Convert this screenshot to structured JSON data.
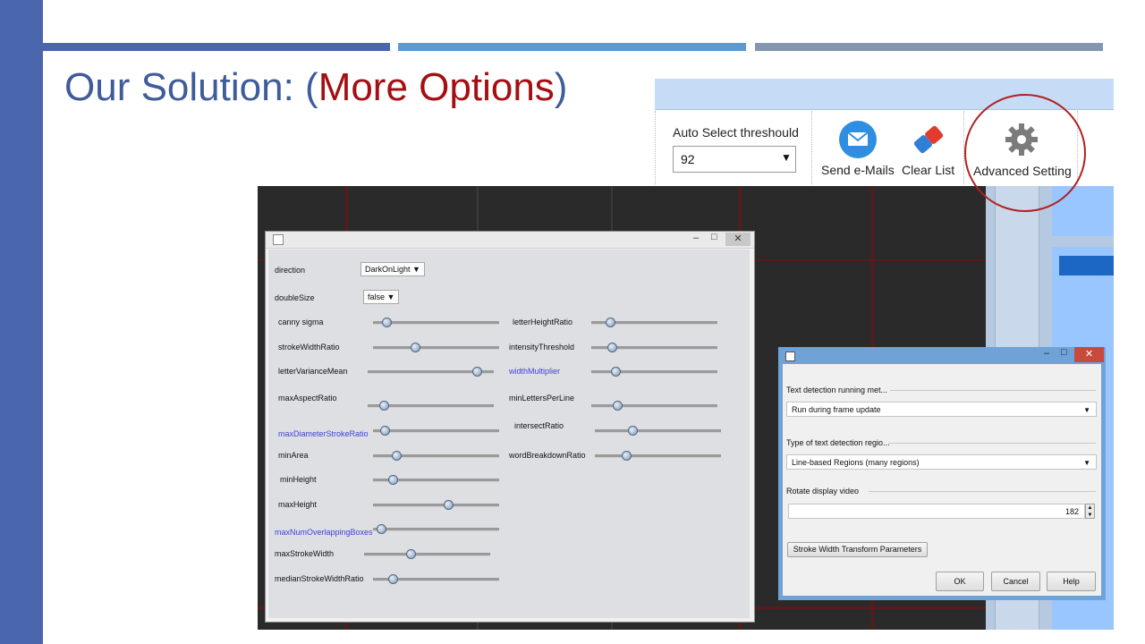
{
  "slide": {
    "title_prefix": "Our Solution: (",
    "title_highlight": "More Options",
    "title_suffix": ")"
  },
  "toolbar": {
    "threshold_label": "Auto Select threshould",
    "threshold_value": "92",
    "send_label": "Send e-Mails",
    "clear_label": "Clear List",
    "advanced_label": "Advanced Setting"
  },
  "swt_dialog": {
    "minimize": "–",
    "maximize": "□",
    "close": "✕",
    "direction_label": "direction",
    "direction_value": "DarkOnLight",
    "doublesize_label": "doubleSize",
    "doublesize_value": "false",
    "sliders_left": [
      {
        "label": "canny sigma",
        "value": 0.08
      },
      {
        "label": "strokeWidthRatio",
        "value": 0.32
      },
      {
        "label": "letterVarianceMean",
        "value": 0.89
      },
      {
        "label": "maxAspectRatio",
        "value": 0.1
      },
      {
        "label": "maxDiameterStrokeRatio",
        "value": 0.06
      },
      {
        "label": "minArea",
        "value": 0.16
      },
      {
        "label": "minHeight",
        "value": 0.13
      },
      {
        "label": "maxHeight",
        "value": 0.6
      },
      {
        "label": "maxNumOverlappingBoxes",
        "value": 0.03
      },
      {
        "label": "maxStrokeWidth",
        "value": 0.36
      },
      {
        "label": "medianStrokeWidthRatio",
        "value": 0.13
      }
    ],
    "sliders_right": [
      {
        "label": "letterHeightRatio",
        "value": 0.12
      },
      {
        "label": "intensityThreshold",
        "value": 0.14
      },
      {
        "label": "widthMultiplier",
        "value": 0.17
      },
      {
        "label": "minLettersPerLine",
        "value": 0.18
      },
      {
        "label": "intersectRatio",
        "value": 0.28
      },
      {
        "label": "wordBreakdownRatio",
        "value": 0.23
      }
    ]
  },
  "options_dialog": {
    "minimize": "–",
    "maximize": "□",
    "close": "✕",
    "run_label": "Text detection running met...",
    "run_value": "Run during frame update",
    "region_label": "Type of text detection regio...",
    "region_value": "Line-based Regions (many regions)",
    "rotate_label": "Rotate display video",
    "rotate_value": "182",
    "swt_button": "Stroke Width Transform Parameters",
    "ok": "OK",
    "cancel": "Cancel",
    "help": "Help"
  },
  "colors": {
    "accent_blue": "#4a66ac",
    "highlight_red": "#a50e12",
    "circle_red": "#b02020"
  }
}
